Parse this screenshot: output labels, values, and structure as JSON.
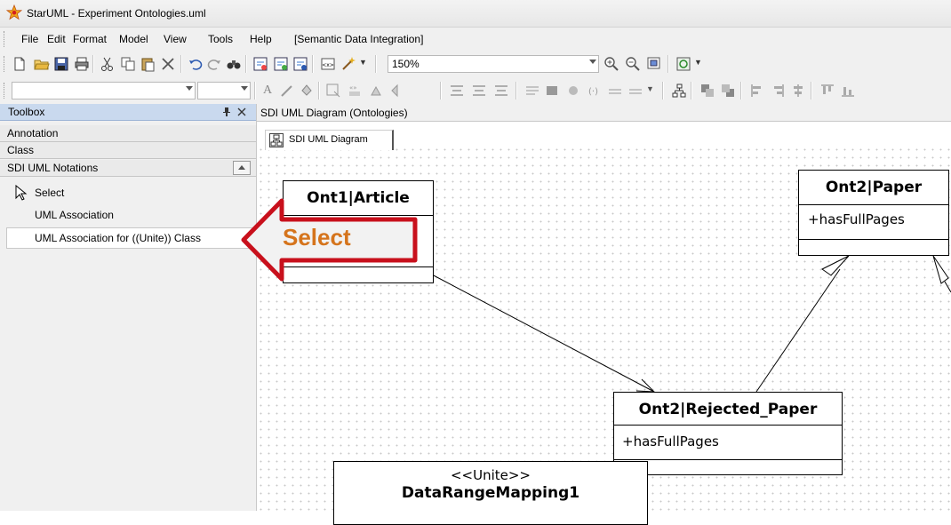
{
  "window": {
    "title": "StarUML - Experiment Ontologies.uml"
  },
  "menu": {
    "items": [
      {
        "label": "File"
      },
      {
        "label": "Edit"
      },
      {
        "label": "Format"
      },
      {
        "label": "Model"
      },
      {
        "label": "View"
      },
      {
        "label": "Tools"
      },
      {
        "label": "Help"
      },
      {
        "label": "[Semantic Data Integration]"
      }
    ]
  },
  "toolbar": {
    "zoom_value": "150%"
  },
  "toolbox": {
    "title": "Toolbox",
    "sections": {
      "annotation": "Annotation",
      "class": "Class",
      "sdi": "SDI UML Notations"
    },
    "tools": {
      "select": "Select",
      "assoc": "UML Association",
      "assoc_unite": "UML Association for ((Unite)) Class"
    }
  },
  "callout": {
    "label": "Select",
    "color": "#c8101c",
    "text_color": "#d5741c"
  },
  "diagram": {
    "panel_title": "SDI UML Diagram (Ontologies)",
    "tab_label": "SDI UML Diagram",
    "classes": {
      "article": {
        "name": "Ont1|Article"
      },
      "paper": {
        "name": "Ont2|Paper",
        "attr": "+hasFullPages"
      },
      "rejected": {
        "name": "Ont2|Rejected_Paper",
        "attr": "+hasFullPages"
      },
      "mapping": {
        "stereotype": "<<Unite>>",
        "name": "DataRangeMapping1"
      }
    }
  }
}
